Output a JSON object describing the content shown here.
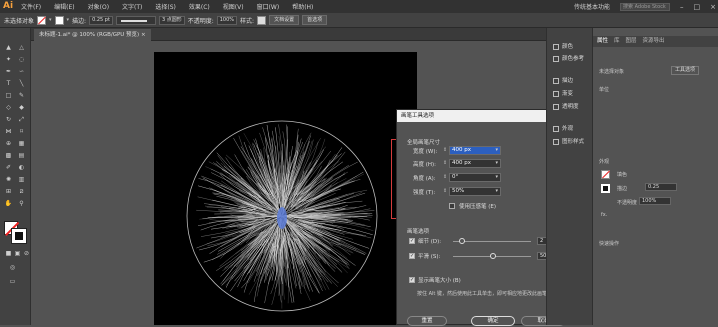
{
  "menubar": {
    "logo": "Ai",
    "items": [
      "文件(F)",
      "编辑(E)",
      "对象(O)",
      "文字(T)",
      "选择(S)",
      "效果(C)",
      "视图(V)",
      "窗口(W)",
      "帮助(H)"
    ],
    "workspace": "传统基本功能",
    "search_placeholder": "搜索 Adobe Stock"
  },
  "controlbar": {
    "selection": "未选择对象",
    "stroke_label": "描边:",
    "stroke_value": "0.25 pt",
    "brush_label": "3 点圆形",
    "opacity_label": "不透明度:",
    "opacity_value": "100%",
    "style_label": "样式:",
    "doc_setup": "文档设置",
    "prefs": "首选项"
  },
  "document": {
    "tab_title": "未标题-1.ai* @ 100% (RGB/GPU 预览)"
  },
  "dialog": {
    "title": "画笔工具选项",
    "global_size": "全局画笔尺寸",
    "width_label": "宽度 (W):",
    "width_value": "400 px",
    "height_label": "高度 (H):",
    "height_value": "400 px",
    "angle_label": "角度 (A):",
    "angle_value": "0°",
    "strength_label": "强度 (T):",
    "strength_value": "50%",
    "use_pressure": "使用压感笔 (E)",
    "brush_options": "画笔选项",
    "detail_label": "细节 (D):",
    "detail_value": "2",
    "smooth_label": "平滑 (S):",
    "smooth_value": "50",
    "show_size": "显示画笔大小 (B)",
    "info": "按住 Alt 键，然后使用此工具单击，即可相应地更改此画笔大小。",
    "reset": "重置",
    "ok": "确定",
    "cancel": "取消"
  },
  "collapsed_panels": [
    "颜色",
    "颜色参考",
    "描边",
    "渐变",
    "透明度",
    "外观",
    "图形样式"
  ],
  "properties": {
    "tabs": [
      "属性",
      "库",
      "图层",
      "资源导出"
    ],
    "no_selection": "未选择对象",
    "unit_label": "单位",
    "tool_options": "工具选项",
    "appearance": "外观",
    "fill_label": "填色",
    "stroke_label": "描边",
    "stroke_value": "0.25",
    "opacity_label": "不透明度",
    "opacity_value": "100%",
    "fx_label": "fx.",
    "quick_actions": "快速操作"
  },
  "colors": {
    "accent": "#2c5fbf",
    "highlight": "#d43c3c",
    "logo": "#f7a13d"
  }
}
